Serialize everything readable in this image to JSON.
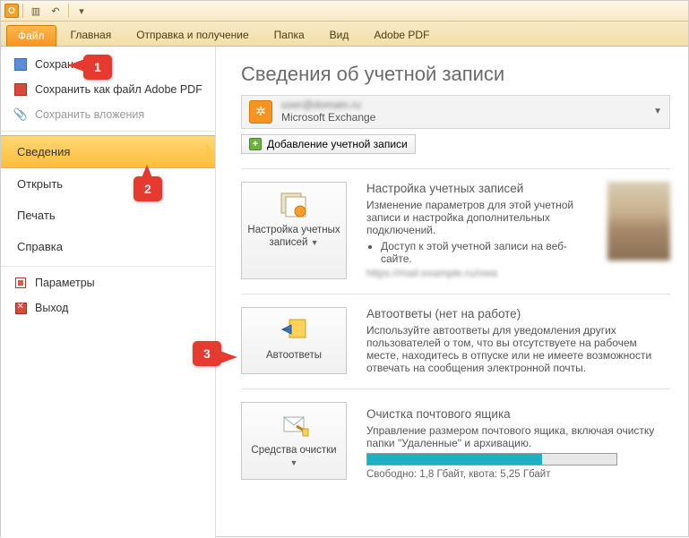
{
  "ribbon": {
    "tabs": [
      "Файл",
      "Главная",
      "Отправка и получение",
      "Папка",
      "Вид",
      "Adobe PDF"
    ]
  },
  "nav": {
    "save": "Сохран",
    "save_pdf": "Сохранить как файл Adobe PDF",
    "save_attach": "Сохранить вложения",
    "info": "Сведения",
    "open": "Открыть",
    "print": "Печать",
    "help": "Справка",
    "options": "Параметры",
    "exit": "Выход"
  },
  "main": {
    "title": "Сведения об учетной записи",
    "account_type": "Microsoft Exchange",
    "add_account": "Добавление учетной записи",
    "s1": {
      "btn": "Настройка учетных записей",
      "title": "Настройка учетных записей",
      "body": "Изменение параметров для этой учетной записи и настройка дополнительных подключений.",
      "bullet": "Доступ к этой учетной записи на веб-сайте."
    },
    "s2": {
      "btn": "Автоответы",
      "title": "Автоответы (нет на работе)",
      "body": "Используйте автоответы для уведомления других пользователей о том, что вы отсутствуете на рабочем месте, находитесь в отпуске или не имеете возможности отвечать на сообщения электронной почты."
    },
    "s3": {
      "btn": "Средства очистки",
      "title": "Очистка почтового ящика",
      "body": "Управление размером почтового ящика, включая очистку папки \"Удаленные\" и архивацию.",
      "quota": "Свободно: 1,8 Гбайт, квота: 5,25 Гбайт"
    }
  },
  "callouts": {
    "c1": "1",
    "c2": "2",
    "c3": "3"
  }
}
